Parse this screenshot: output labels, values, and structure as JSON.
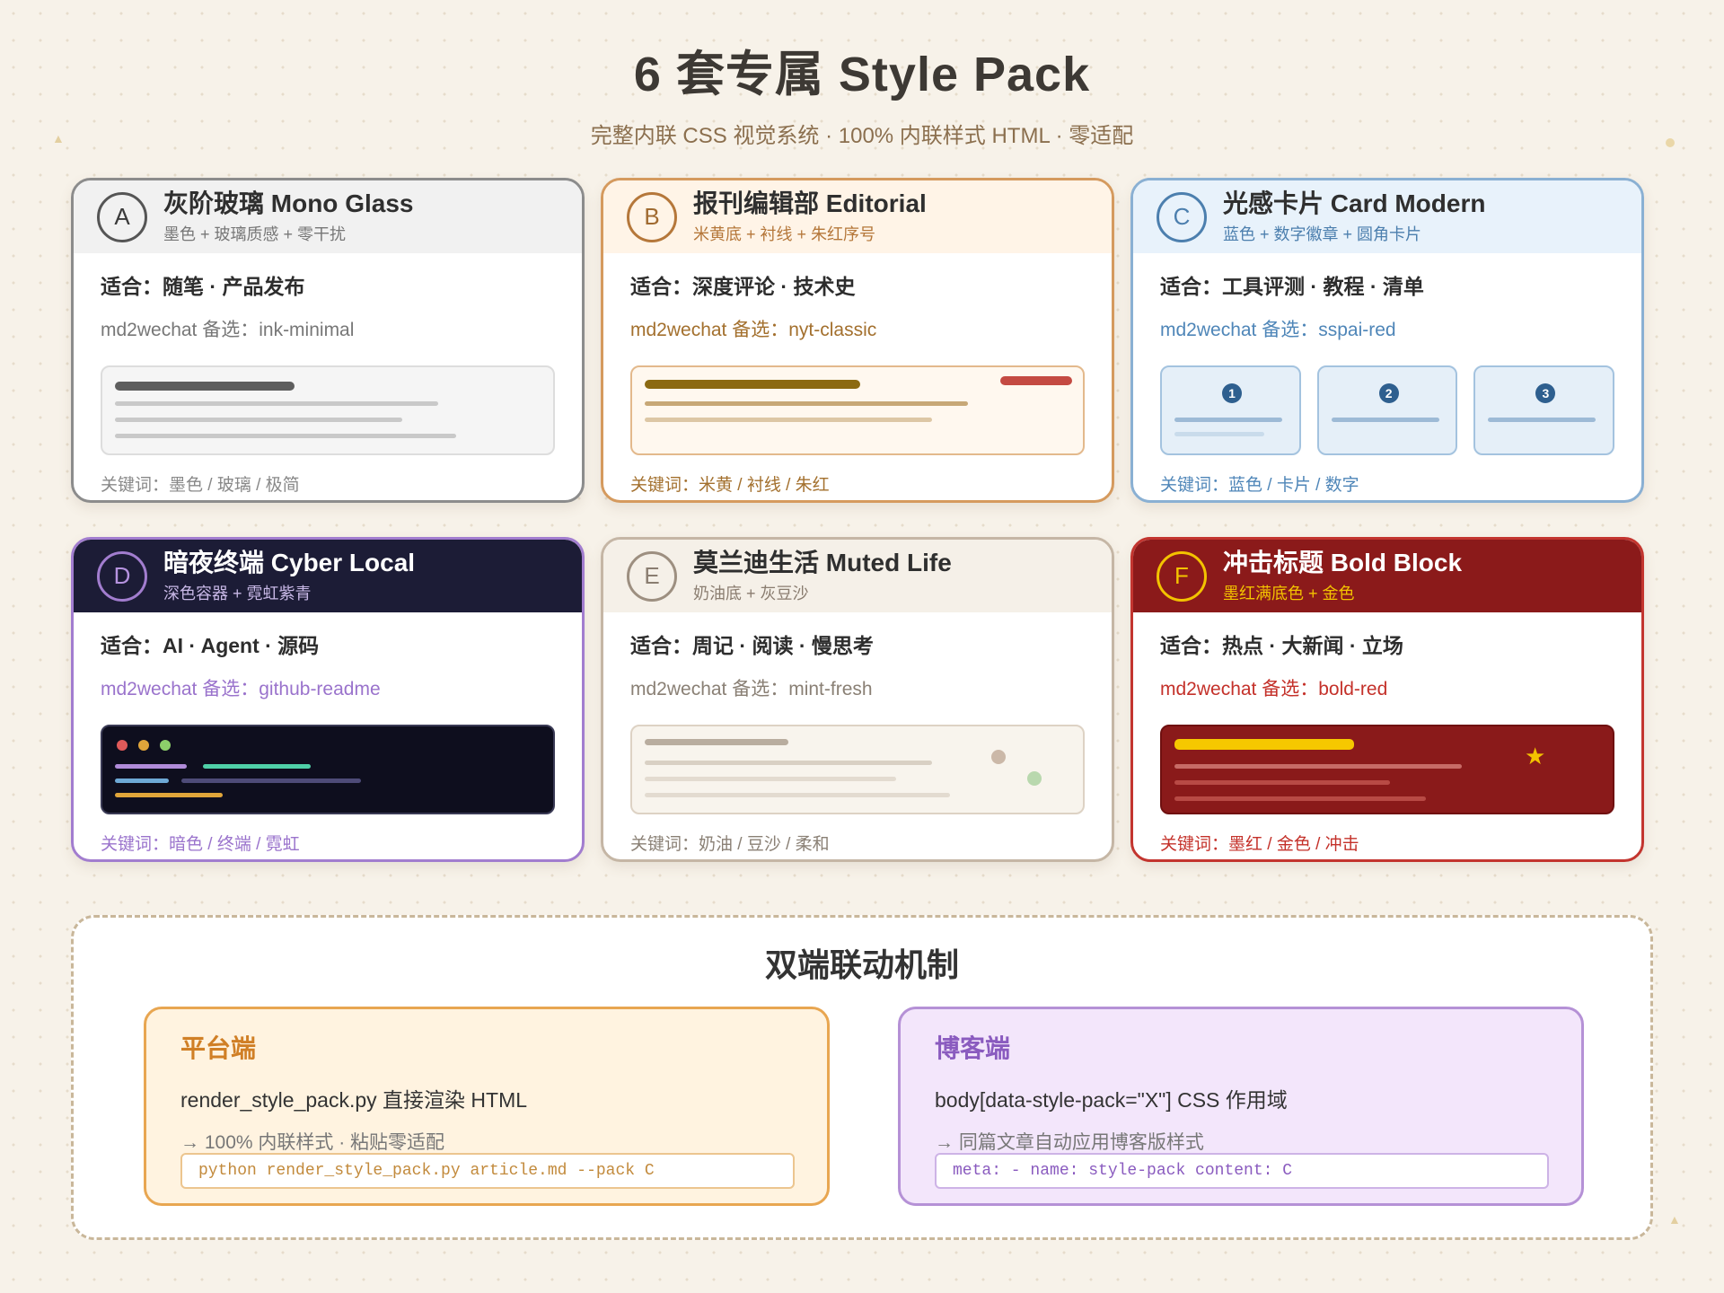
{
  "header": {
    "title": "6 套专属 Style Pack",
    "subtitle": "完整内联 CSS 视觉系统 · 100% 内联样式 HTML · 零适配"
  },
  "packs": [
    {
      "letter": "A",
      "title": "灰阶玻璃 Mono Glass",
      "subtitle": "墨色 + 玻璃质感 + 零干扰",
      "fit": "适合：随笔 · 产品发布",
      "alt": "md2wechat 备选：ink-minimal",
      "keywords": "关键词：墨色 / 玻璃 / 极简",
      "accent": "#8c8c8c"
    },
    {
      "letter": "B",
      "title": "报刊编辑部 Editorial",
      "subtitle": "米黄底 + 衬线 + 朱红序号",
      "fit": "适合：深度评论 · 技术史",
      "alt": "md2wechat 备选：nyt-classic",
      "keywords": "关键词：米黄 / 衬线 / 朱红",
      "accent": "#d59a5e"
    },
    {
      "letter": "C",
      "title": "光感卡片 Card Modern",
      "subtitle": "蓝色 + 数字徽章 + 圆角卡片",
      "fit": "适合：工具评测 · 教程 · 清单",
      "alt": "md2wechat 备选：sspai-red",
      "keywords": "关键词：蓝色 / 卡片 / 数字",
      "accent": "#8ab0d3",
      "badges": [
        "1",
        "2",
        "3"
      ]
    },
    {
      "letter": "D",
      "title": "暗夜终端 Cyber Local",
      "subtitle": "深色容器 + 霓虹紫青",
      "fit": "适合：AI · Agent · 源码",
      "alt": "md2wechat 备选：github-readme",
      "keywords": "关键词：暗色 / 终端 / 霓虹",
      "accent": "#a27dcf"
    },
    {
      "letter": "E",
      "title": "莫兰迪生活 Muted Life",
      "subtitle": "奶油底 + 灰豆沙",
      "fit": "适合：周记 · 阅读 · 慢思考",
      "alt": "md2wechat 备选：mint-fresh",
      "keywords": "关键词：奶油 / 豆沙 / 柔和",
      "accent": "#c5b6a5"
    },
    {
      "letter": "F",
      "title": "冲击标题 Bold Block",
      "subtitle": "墨红满底色 + 金色",
      "fit": "适合：热点 · 大新闻 · 立场",
      "alt": "md2wechat 备选：bold-red",
      "keywords": "关键词：墨红 / 金色 / 冲击",
      "accent": "#c3352f",
      "star": "★"
    }
  ],
  "mechanism": {
    "title": "双端联动机制",
    "platform": {
      "title": "平台端",
      "line1": "render_style_pack.py 直接渲染 HTML",
      "line2": "→ 100% 内联样式 · 粘贴零适配",
      "code": "python render_style_pack.py article.md --pack C"
    },
    "blog": {
      "title": "博客端",
      "line1": "body[data-style-pack=\"X\"] CSS 作用域",
      "line2": "→ 同篇文章自动应用博客版样式",
      "code": "meta: - name: style-pack content: C"
    }
  }
}
